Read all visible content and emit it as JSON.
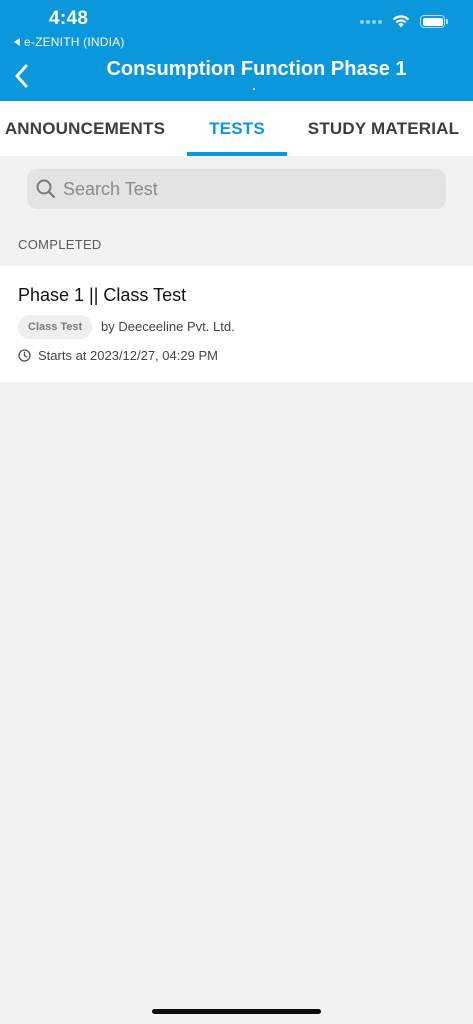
{
  "status_bar": {
    "time": "4:48",
    "back_app": "e-ZENITH (INDIA)"
  },
  "nav": {
    "title": "Consumption Function Phase 1",
    "back_icon": "chevron-left-icon"
  },
  "tabs": [
    {
      "label": "ANNOUNCEMENTS",
      "active": false
    },
    {
      "label": "TESTS",
      "active": true
    },
    {
      "label": "STUDY MATERIAL",
      "active": false
    }
  ],
  "search": {
    "placeholder": "Search Test",
    "value": ""
  },
  "section": {
    "label": "COMPLETED"
  },
  "tests": [
    {
      "title": "Phase 1 || Class Test",
      "badge": "Class Test",
      "author": "by Deeceeline Pvt. Ltd.",
      "starts": "Starts at 2023/12/27, 04:29 PM"
    }
  ],
  "colors": {
    "brand": "#0a97dc",
    "background": "#f2f2f2",
    "card": "#ffffff"
  }
}
